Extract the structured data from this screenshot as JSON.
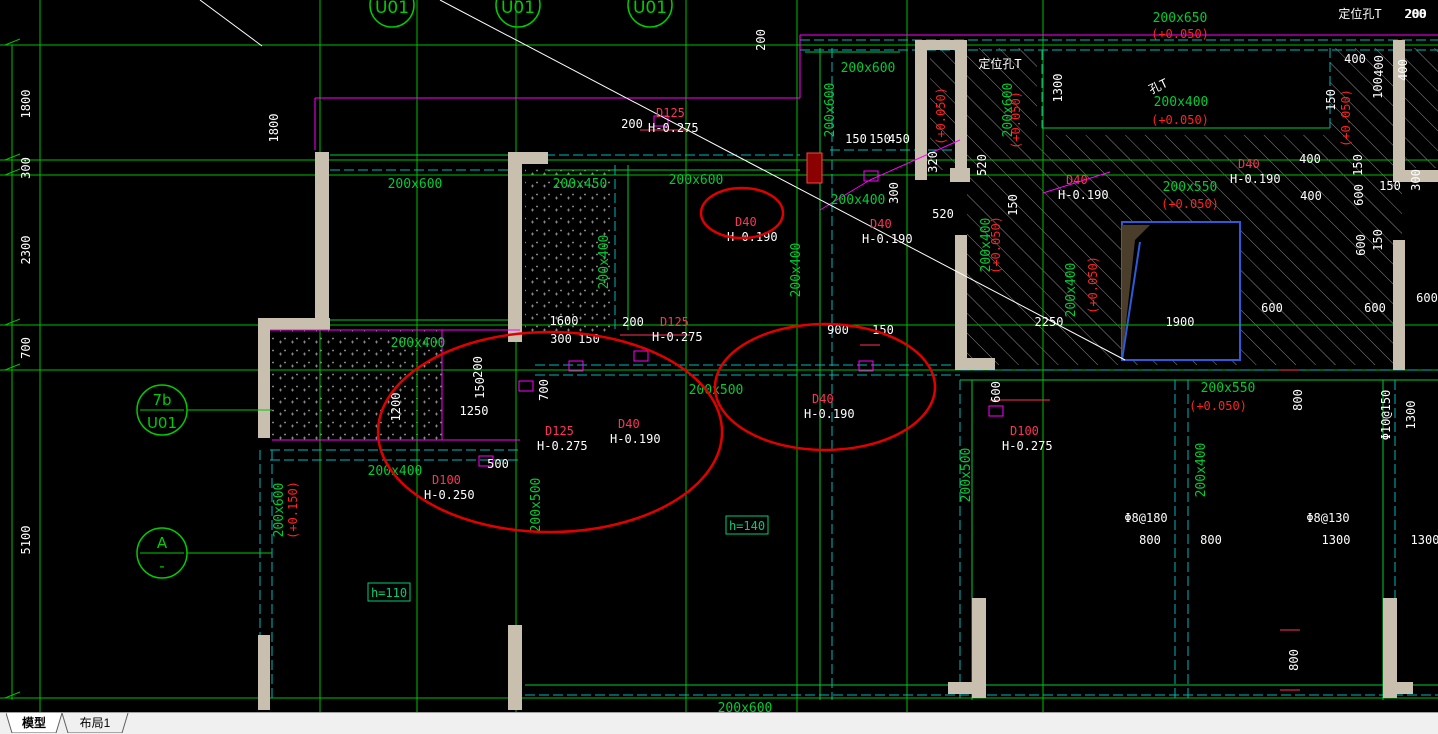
{
  "colors": {
    "background": "#000000",
    "axis": "#00c000",
    "beam": "#00cc33",
    "beam_dashed": "#00b8b8",
    "wall": "#c8bfae",
    "dimension_text": "#ffffff",
    "pipe_magenta": "#ff00ff",
    "pipe_red": "#ff3355",
    "highlight_circle": "#e00000",
    "slab_tag": "#00cc77",
    "red_label": "#ff2222",
    "axis_bubble": "#00cc00"
  },
  "axis_bubbles": [
    {
      "line1": "7b",
      "line2": "U01"
    },
    {
      "line1": "A",
      "line2": "-"
    },
    {
      "line1": "U01",
      "line2": ""
    },
    {
      "line1": "U01",
      "line2": ""
    },
    {
      "line1": "U01",
      "line2": ""
    }
  ],
  "left_dims": [
    "1800",
    "300",
    "2300",
    "700",
    "5100"
  ],
  "beam_labels": [
    "200x650",
    "200x600",
    "200x600",
    "200x600",
    "200x450",
    "200x400",
    "200x400",
    "200x400",
    "200x400",
    "200x400",
    "200x500",
    "200x500",
    "200x500",
    "200x550",
    "200x550",
    "200x400",
    "200x400",
    "200x600",
    "200x600",
    "200x600",
    "200x600",
    "200x400",
    "200x400"
  ],
  "red_elevations": [
    "(+0.050)",
    "(+0.050)",
    "(+0.050)",
    "(+0.050)",
    "(+0.050)",
    "(+0.050)",
    "(+0.050)",
    "(+0.150)",
    "(+0.050)",
    "(+0.050)"
  ],
  "pipes": [
    {
      "size": "D125",
      "elev": "H-0.275"
    },
    {
      "size": "D40",
      "elev": "H-0.190"
    },
    {
      "size": "D40",
      "elev": "H-0.190"
    },
    {
      "size": "D125",
      "elev": "H-0.275"
    },
    {
      "size": "D40",
      "elev": "H-0.190"
    },
    {
      "size": "D125",
      "elev": "H-0.275"
    },
    {
      "size": "D100",
      "elev": "H-0.250"
    },
    {
      "size": "D40",
      "elev": "H-0.190"
    },
    {
      "size": "D100",
      "elev": "H-0.275"
    },
    {
      "size": "D40",
      "elev": "H-0.190"
    },
    {
      "size": "D40",
      "elev": "H-0.190"
    }
  ],
  "dims": [
    "200",
    "1800",
    "200",
    "150",
    "150",
    "450",
    "320",
    "300",
    "520",
    "520",
    "150",
    "1300",
    "400",
    "400",
    "150",
    "600",
    "150",
    "600",
    "150",
    "1600",
    "300",
    "150",
    "200",
    "900",
    "150",
    "2250",
    "1900",
    "600",
    "600",
    "600",
    "200",
    "150",
    "700",
    "1250",
    "1200",
    "500",
    "600",
    "800",
    "1300",
    "400",
    "100",
    "150",
    "300",
    "800",
    "800",
    "1300",
    "1300",
    "800",
    "400",
    "400",
    "200"
  ],
  "rebar_labels": [
    "Φ8@180",
    "Φ8@130",
    "Φ10@150"
  ],
  "slab_tags": [
    "h=140",
    "h=110"
  ],
  "notes": [
    "定位孔T",
    "定位孔T",
    "孔T",
    "200"
  ],
  "tabs": [
    {
      "label": "模型",
      "active": true
    },
    {
      "label": "布局1",
      "active": false
    }
  ]
}
